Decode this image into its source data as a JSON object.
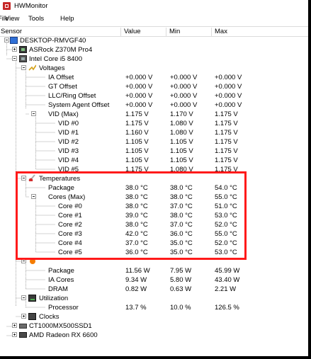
{
  "window": {
    "title": "HWMonitor"
  },
  "menu": [
    "File",
    "View",
    "Tools",
    "Help"
  ],
  "columns": {
    "sensor": "Sensor",
    "value": "Value",
    "min": "Min",
    "max": "Max"
  },
  "tree": {
    "computer": "DESKTOP-RMVGF40",
    "motherboard": "ASRock Z370M Pro4",
    "cpu": "Intel Core i5 8400",
    "voltages": {
      "label": "Voltages",
      "rows": [
        {
          "name": "IA Offset",
          "value": "+0.000 V",
          "min": "+0.000 V",
          "max": "+0.000 V"
        },
        {
          "name": "GT Offset",
          "value": "+0.000 V",
          "min": "+0.000 V",
          "max": "+0.000 V"
        },
        {
          "name": "LLC/Ring Offset",
          "value": "+0.000 V",
          "min": "+0.000 V",
          "max": "+0.000 V"
        },
        {
          "name": "System Agent Offset",
          "value": "+0.000 V",
          "min": "+0.000 V",
          "max": "+0.000 V"
        },
        {
          "name": "VID (Max)",
          "value": "1.175 V",
          "min": "1.170 V",
          "max": "1.175 V"
        },
        {
          "name": "VID #0",
          "value": "1.175 V",
          "min": "1.080 V",
          "max": "1.175 V"
        },
        {
          "name": "VID #1",
          "value": "1.160 V",
          "min": "1.080 V",
          "max": "1.175 V"
        },
        {
          "name": "VID #2",
          "value": "1.105 V",
          "min": "1.105 V",
          "max": "1.175 V"
        },
        {
          "name": "VID #3",
          "value": "1.105 V",
          "min": "1.105 V",
          "max": "1.175 V"
        },
        {
          "name": "VID #4",
          "value": "1.105 V",
          "min": "1.105 V",
          "max": "1.175 V"
        },
        {
          "name": "VID #5",
          "value": "1.175 V",
          "min": "1.080 V",
          "max": "1.175 V"
        }
      ]
    },
    "temperatures": {
      "label": "Temperatures",
      "rows": [
        {
          "name": "Package",
          "value": "38.0 °C",
          "min": "38.0 °C",
          "max": "54.0 °C"
        },
        {
          "name": "Cores (Max)",
          "value": "38.0 °C",
          "min": "38.0 °C",
          "max": "55.0 °C"
        },
        {
          "name": "Core #0",
          "value": "38.0 °C",
          "min": "37.0 °C",
          "max": "51.0 °C"
        },
        {
          "name": "Core #1",
          "value": "39.0 °C",
          "min": "38.0 °C",
          "max": "53.0 °C"
        },
        {
          "name": "Core #2",
          "value": "38.0 °C",
          "min": "37.0 °C",
          "max": "52.0 °C"
        },
        {
          "name": "Core #3",
          "value": "42.0 °C",
          "min": "36.0 °C",
          "max": "55.0 °C"
        },
        {
          "name": "Core #4",
          "value": "37.0 °C",
          "min": "35.0 °C",
          "max": "52.0 °C"
        },
        {
          "name": "Core #5",
          "value": "36.0 °C",
          "min": "35.0 °C",
          "max": "53.0 °C"
        }
      ]
    },
    "powers": {
      "rows": [
        {
          "name": "Package",
          "value": "11.56 W",
          "min": "7.95 W",
          "max": "45.99 W"
        },
        {
          "name": "IA Cores",
          "value": "9.34 W",
          "min": "5.80 W",
          "max": "43.40 W"
        },
        {
          "name": "DRAM",
          "value": "0.82 W",
          "min": "0.63 W",
          "max": "2.21 W"
        }
      ]
    },
    "utilization": {
      "label": "Utilization",
      "rows": [
        {
          "name": "Processor",
          "value": "13.7 %",
          "min": "10.0 %",
          "max": "126.5 %"
        }
      ]
    },
    "clocks": {
      "label": "Clocks"
    },
    "drive": "CT1000MX500SSD1",
    "gpu": "AMD Radeon RX 6600"
  },
  "colors": {
    "highlight": "#ff1a1a",
    "selection": "#2f6fd6"
  }
}
